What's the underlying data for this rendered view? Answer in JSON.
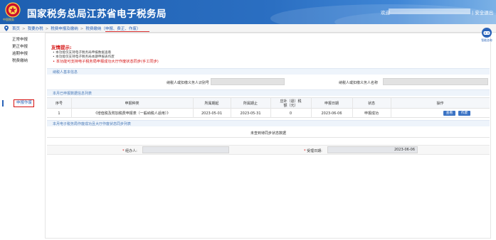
{
  "header": {
    "title": "国家税务总局江苏省电子税务局",
    "logo_caption": "中国税务",
    "welcome": "欢迎",
    "logout": "| 安全退出"
  },
  "breadcrumb": {
    "items": [
      "首页",
      "我要办税",
      "税费申报及缴纳",
      "税费缴纳（申报、费正、作废）"
    ]
  },
  "sidebar": {
    "items": [
      "正常申报",
      "更正申报",
      "逾期申报",
      "税费缴纳",
      "申报作废"
    ]
  },
  "tips": {
    "title": "友情提示:",
    "lines": [
      "• 本功能仅支持电子税务局申报数据查看",
      "• 本功能仅支持电子税务局本期申报表作废",
      "• 本功能可支持电子税务局申报成功大厅作废状态同步(手工同步)"
    ]
  },
  "basic_info": {
    "section_title": "纳税人基本信息",
    "taxpayer_id_label": "纳税人或扣缴义务人识别号",
    "taxpayer_name_label": "纳税人或扣缴义务人名称"
  },
  "declared_table": {
    "section_title": "本月已申报数据信息列表",
    "headers": [
      "序号",
      "申报种类",
      "所属期起",
      "所属期止",
      "应补（退）税额（元）",
      "申报日期",
      "状态",
      "操作"
    ],
    "rows": [
      {
        "index": "1",
        "type": "《增值税及附加税费申报表（一般纳税人适用）》",
        "period_start": "2023-05-01",
        "period_end": "2023-05-31",
        "amount": "0",
        "declare_date": "2023-06-06",
        "status": "申报成功",
        "actions": [
          "查看",
          "作废"
        ]
      }
    ]
  },
  "hall_section": {
    "section_title": "本月电子税务局作废成功且大厅作废状态同步列表",
    "empty_text": "未查到待同步状态数据"
  },
  "signoff": {
    "handler_label": "经办人:",
    "date_label": "受理日期:",
    "date_value": "2023-06-06"
  },
  "consult": {
    "label": "智能咨询"
  },
  "colors": {
    "header_blue": "#1e5fb0",
    "link_blue": "#2a63b8",
    "alert_red": "#d41010",
    "button_blue": "#3b73c4"
  }
}
